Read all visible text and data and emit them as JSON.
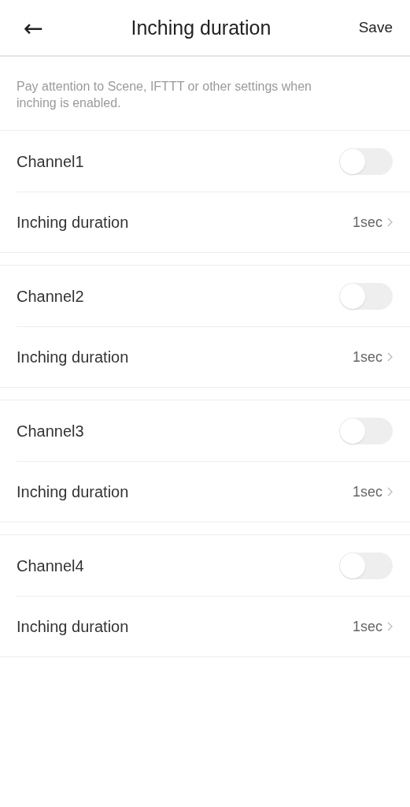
{
  "header": {
    "back": "←",
    "title": "Inching duration",
    "action": "Save"
  },
  "notice": "Pay attention to Scene, IFTTT or other settings when inching is enabled.",
  "channels": [
    {
      "name": "Channel1",
      "on": false,
      "duration_label": "Inching duration",
      "duration": "1sec"
    },
    {
      "name": "Channel2",
      "on": false,
      "duration_label": "Inching duration",
      "duration": "1sec"
    },
    {
      "name": "Channel3",
      "on": false,
      "duration_label": "Inching duration",
      "duration": "1sec"
    },
    {
      "name": "Channel4",
      "on": false,
      "duration_label": "Inching duration",
      "duration": "1sec"
    }
  ]
}
